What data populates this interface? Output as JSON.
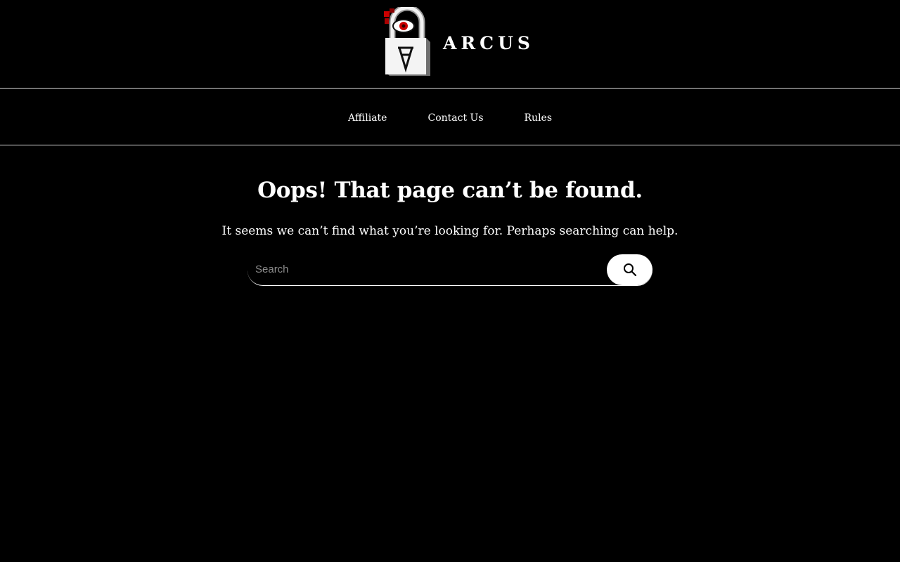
{
  "header": {
    "site_name": "ARCUS",
    "logo_icon": "padlock-eye-logo-icon"
  },
  "nav": {
    "items": [
      {
        "label": "Affiliate"
      },
      {
        "label": "Contact Us"
      },
      {
        "label": "Rules"
      }
    ]
  },
  "main": {
    "title": "Oops! That page can’t be found.",
    "message": "It seems we can’t find what you’re looking for. Perhaps searching can help."
  },
  "search": {
    "placeholder": "Search",
    "value": "",
    "button_icon": "search-icon"
  },
  "colors": {
    "background": "#000000",
    "text": "#ffffff",
    "divider": "#d9d9d9",
    "logo_accent": "#cc0000"
  }
}
